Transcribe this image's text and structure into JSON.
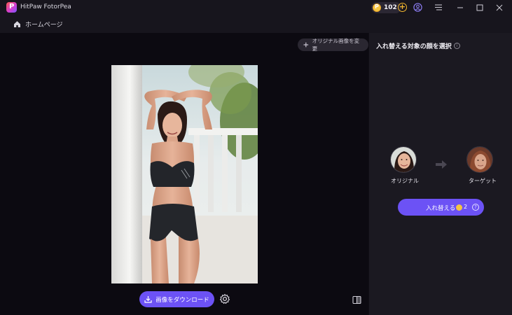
{
  "app": {
    "title": "HitPaw FotorPea"
  },
  "titlebar": {
    "coin_count": "102",
    "coin_add": "+"
  },
  "nav": {
    "home_label": "ホームページ"
  },
  "canvas": {
    "replace_original_label": "オリジナル画像を変更",
    "download_label": "画像をダウンロード"
  },
  "panel": {
    "title": "入れ替える対象の顔を選択",
    "info": "i",
    "original_label": "オリジナル",
    "target_label": "ターゲット",
    "swap_label": "入れ替える",
    "swap_cost": "2",
    "swap_help": "?"
  },
  "colors": {
    "accent": "#6c52f5",
    "coin": "#f5c542",
    "panel_bg": "#1b1921",
    "canvas_bg": "#0c0a11"
  },
  "icons": {
    "logo": "app-logo",
    "coin": "coin-icon",
    "user": "user-icon",
    "menu": "menu-icon",
    "home": "home-icon",
    "download": "download-icon",
    "settings": "gear-icon",
    "compare": "compare-icon"
  }
}
